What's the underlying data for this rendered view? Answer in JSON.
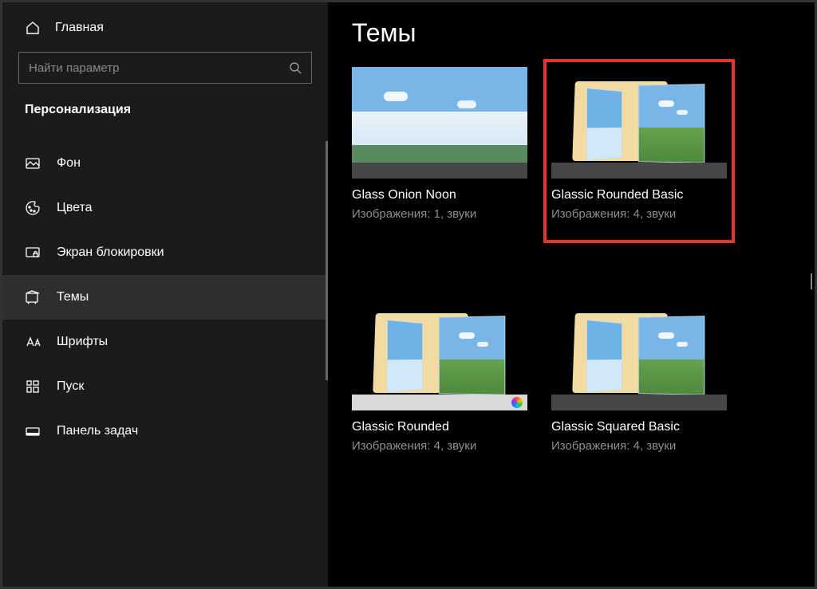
{
  "sidebar": {
    "home": "Главная",
    "search_placeholder": "Найти параметр",
    "section": "Персонализация",
    "items": [
      {
        "id": "background",
        "label": "Фон"
      },
      {
        "id": "colors",
        "label": "Цвета"
      },
      {
        "id": "lockscreen",
        "label": "Экран блокировки"
      },
      {
        "id": "themes",
        "label": "Темы"
      },
      {
        "id": "fonts",
        "label": "Шрифты"
      },
      {
        "id": "start",
        "label": "Пуск"
      },
      {
        "id": "taskbar",
        "label": "Панель задач"
      }
    ],
    "active_id": "themes"
  },
  "main": {
    "heading": "Темы",
    "themes": [
      {
        "title": "Glass Onion Noon",
        "meta": "Изображения: 1, звуки",
        "variant": "mountain",
        "taskbar": "dark",
        "highlighted": false
      },
      {
        "title": "Glassic Rounded Basic",
        "meta": "Изображения: 4, звуки",
        "variant": "folder",
        "taskbar": "dark",
        "highlighted": true
      },
      {
        "title": "Glassic Rounded",
        "meta": "Изображения: 4, звуки",
        "variant": "folder",
        "taskbar": "light",
        "highlighted": false,
        "colorwheel": true
      },
      {
        "title": "Glassic Squared Basic",
        "meta": "Изображения: 4, звуки",
        "variant": "folder",
        "taskbar": "dark",
        "highlighted": false
      }
    ]
  }
}
